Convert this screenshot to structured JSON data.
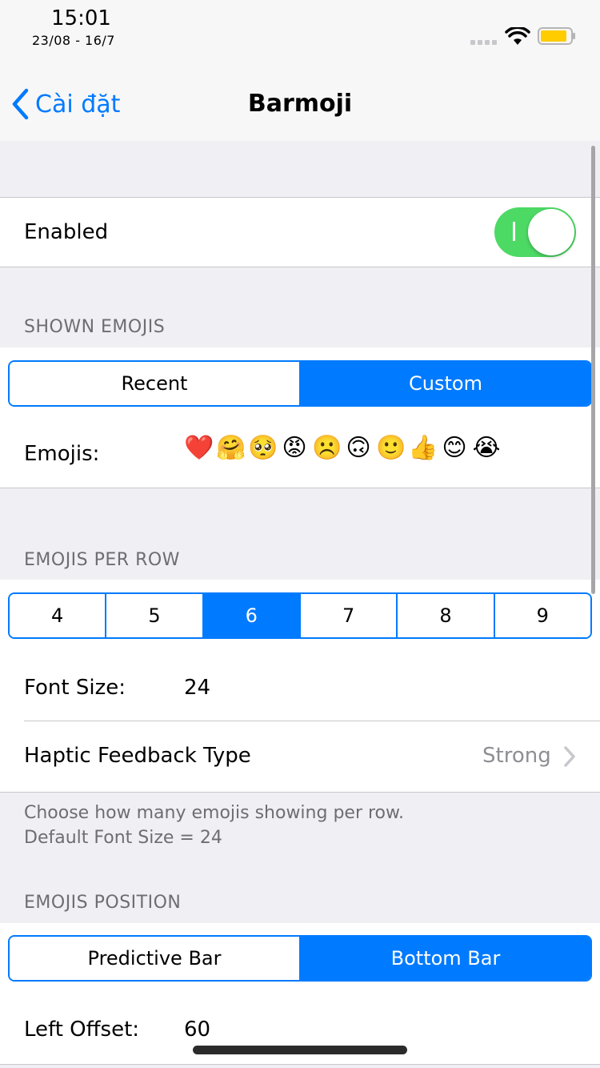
{
  "status": {
    "time": "15:01",
    "date": "23/08 - 16/7"
  },
  "nav": {
    "back_label": "Cài đặt",
    "title": "Barmoji"
  },
  "enabled": {
    "label": "Enabled",
    "toggle_glyph": "I",
    "on": true
  },
  "shown_emojis": {
    "header": "SHOWN EMOJIS",
    "options": [
      "Recent",
      "Custom"
    ],
    "selected": "Custom",
    "emojis_label": "Emojis:",
    "emojis": [
      "❤️",
      "🤗",
      "🥺",
      "😡",
      "☹️",
      "🙃",
      "🙂",
      "👍",
      "😊",
      "😭"
    ]
  },
  "emojis_per_row": {
    "header": "EMOJIS PER ROW",
    "options": [
      "4",
      "5",
      "6",
      "7",
      "8",
      "9"
    ],
    "selected": "6",
    "font_size_label": "Font Size:",
    "font_size_value": "24",
    "haptic_label": "Haptic Feedback Type",
    "haptic_value": "Strong",
    "footer_line1": "Choose how many emojis showing per row.",
    "footer_line2": "Default Font Size = 24"
  },
  "emojis_position": {
    "header": "EMOJIS POSITION",
    "options": [
      "Predictive Bar",
      "Bottom Bar"
    ],
    "selected": "Bottom Bar",
    "left_offset_label": "Left Offset:",
    "left_offset_value": "60"
  },
  "colors": {
    "accent": "#007aff",
    "toggle_on": "#4cd964",
    "battery": "#ffcc00",
    "background": "#efeff4"
  }
}
